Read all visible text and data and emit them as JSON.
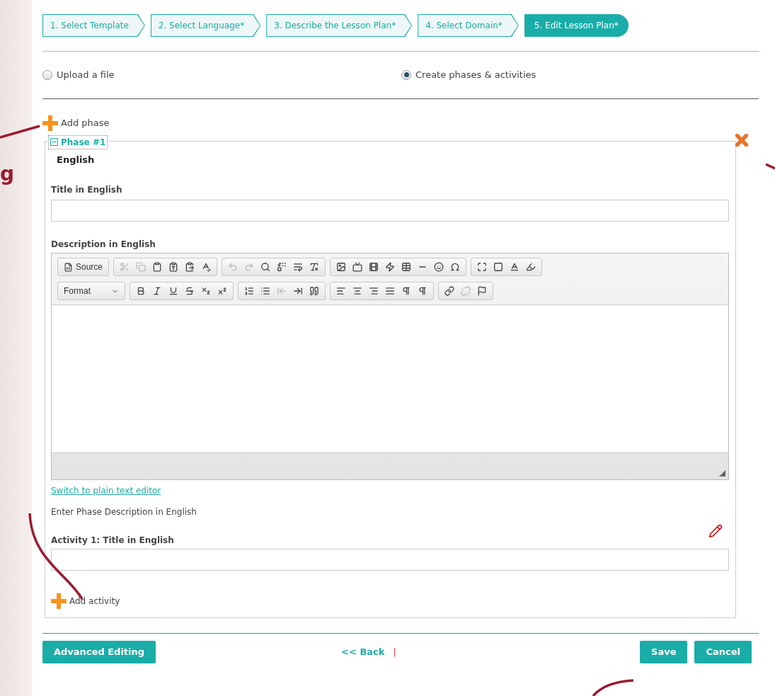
{
  "steps": [
    {
      "label": "1. Select Template",
      "selected": false
    },
    {
      "label": "2. Select Language*",
      "selected": false
    },
    {
      "label": "3. Describe the Lesson Plan*",
      "selected": false
    },
    {
      "label": "4. Select Domain*",
      "selected": false
    },
    {
      "label": "5. Edit Lesson Plan*",
      "selected": true
    }
  ],
  "mode_options": [
    {
      "label": "Upload a file",
      "selected": false
    },
    {
      "label": "Create phases & activities",
      "selected": true
    }
  ],
  "add_phase": "Add phase",
  "callout_text": "g",
  "phase": {
    "legend": "Phase #1",
    "expanded": true,
    "language": "English",
    "title_label": "Title in English",
    "description_label": "Description in English",
    "editor": {
      "source": "Source",
      "format": "Format"
    },
    "switch_link": "Switch to plain text editor",
    "hint": "Enter Phase Description in English",
    "activity_label": "Activity 1: Title in English",
    "add_activity": "Add activity"
  },
  "footer": {
    "advanced": "Advanced Editing",
    "back": "<< Back",
    "separator": "|",
    "save": "Save",
    "cancel": "Cancel"
  }
}
